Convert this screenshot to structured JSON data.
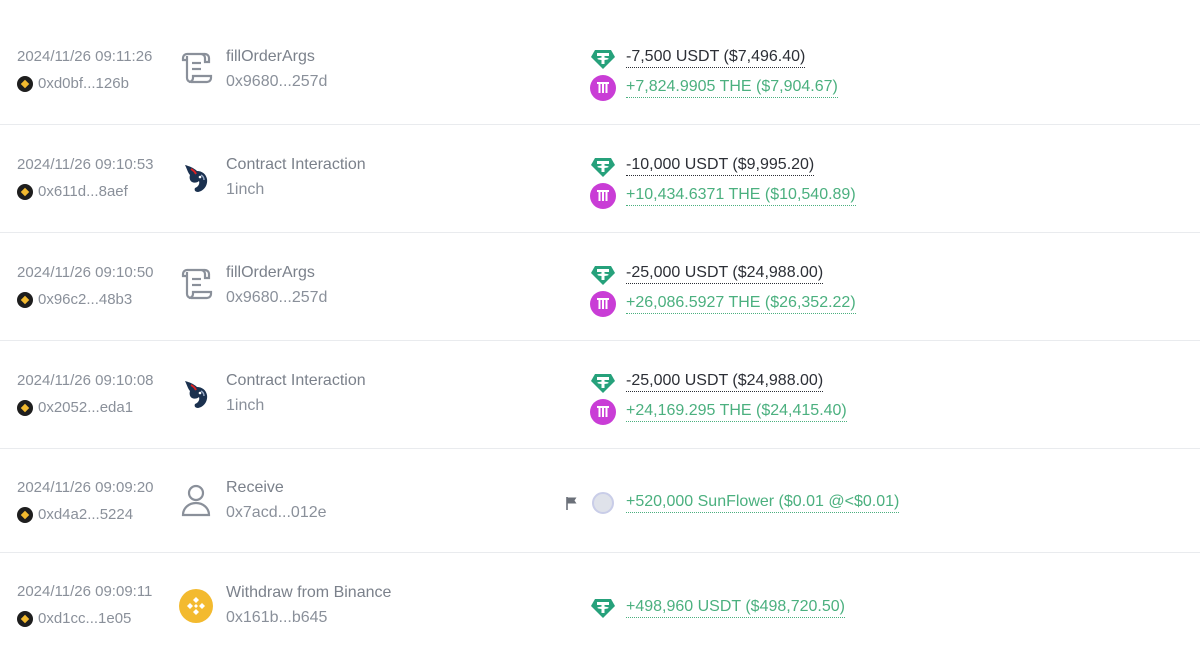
{
  "rows": [
    {
      "time": "2024/11/26 09:11:26",
      "address": "0xd0bf...126b",
      "tx_type": "fillOrderArgs",
      "tx_sub": "0x9680...257d",
      "tx_icon": "scroll-icon",
      "changes": [
        {
          "token": "tether-icon",
          "text": "-7,500 USDT ($7,496.40)",
          "direction": "out"
        },
        {
          "token": "the-token-icon",
          "text": "+7,824.9905 THE ($7,904.67)",
          "direction": "in"
        }
      ]
    },
    {
      "time": "2024/11/26 09:10:53",
      "address": "0x611d...8aef",
      "tx_type": "Contract Interaction",
      "tx_sub": "1inch",
      "tx_icon": "1inch-unicorn-icon",
      "changes": [
        {
          "token": "tether-icon",
          "text": "-10,000 USDT ($9,995.20)",
          "direction": "out"
        },
        {
          "token": "the-token-icon",
          "text": "+10,434.6371 THE ($10,540.89)",
          "direction": "in"
        }
      ]
    },
    {
      "time": "2024/11/26 09:10:50",
      "address": "0x96c2...48b3",
      "tx_type": "fillOrderArgs",
      "tx_sub": "0x9680...257d",
      "tx_icon": "scroll-icon",
      "changes": [
        {
          "token": "tether-icon",
          "text": "-25,000 USDT ($24,988.00)",
          "direction": "out"
        },
        {
          "token": "the-token-icon",
          "text": "+26,086.5927 THE ($26,352.22)",
          "direction": "in"
        }
      ]
    },
    {
      "time": "2024/11/26 09:10:08",
      "address": "0x2052...eda1",
      "tx_type": "Contract Interaction",
      "tx_sub": "1inch",
      "tx_icon": "1inch-unicorn-icon",
      "changes": [
        {
          "token": "tether-icon",
          "text": "-25,000 USDT ($24,988.00)",
          "direction": "out"
        },
        {
          "token": "the-token-icon",
          "text": "+24,169.295 THE ($24,415.40)",
          "direction": "in"
        }
      ]
    },
    {
      "time": "2024/11/26 09:09:20",
      "address": "0xd4a2...5224",
      "tx_type": "Receive",
      "tx_sub": "0x7acd...012e",
      "tx_icon": "user-icon",
      "changes": [
        {
          "token": "sunflower-token-icon",
          "text": "+520,000 SunFlower ($0.01 @<$0.01)",
          "direction": "in",
          "flagged": true
        }
      ]
    },
    {
      "time": "2024/11/26 09:09:11",
      "address": "0xd1cc...1e05",
      "tx_type": "Withdraw from Binance",
      "tx_sub": "0x161b...b645",
      "tx_icon": "binance-icon",
      "changes": [
        {
          "token": "tether-icon",
          "text": "+498,960 USDT ($498,720.50)",
          "direction": "in"
        }
      ]
    }
  ],
  "colors": {
    "positive": "#4bb07f",
    "negative": "#2c2f36",
    "tether": "#26a17b",
    "the_token": "#c93dd6",
    "binance": "#f3ba2f"
  }
}
